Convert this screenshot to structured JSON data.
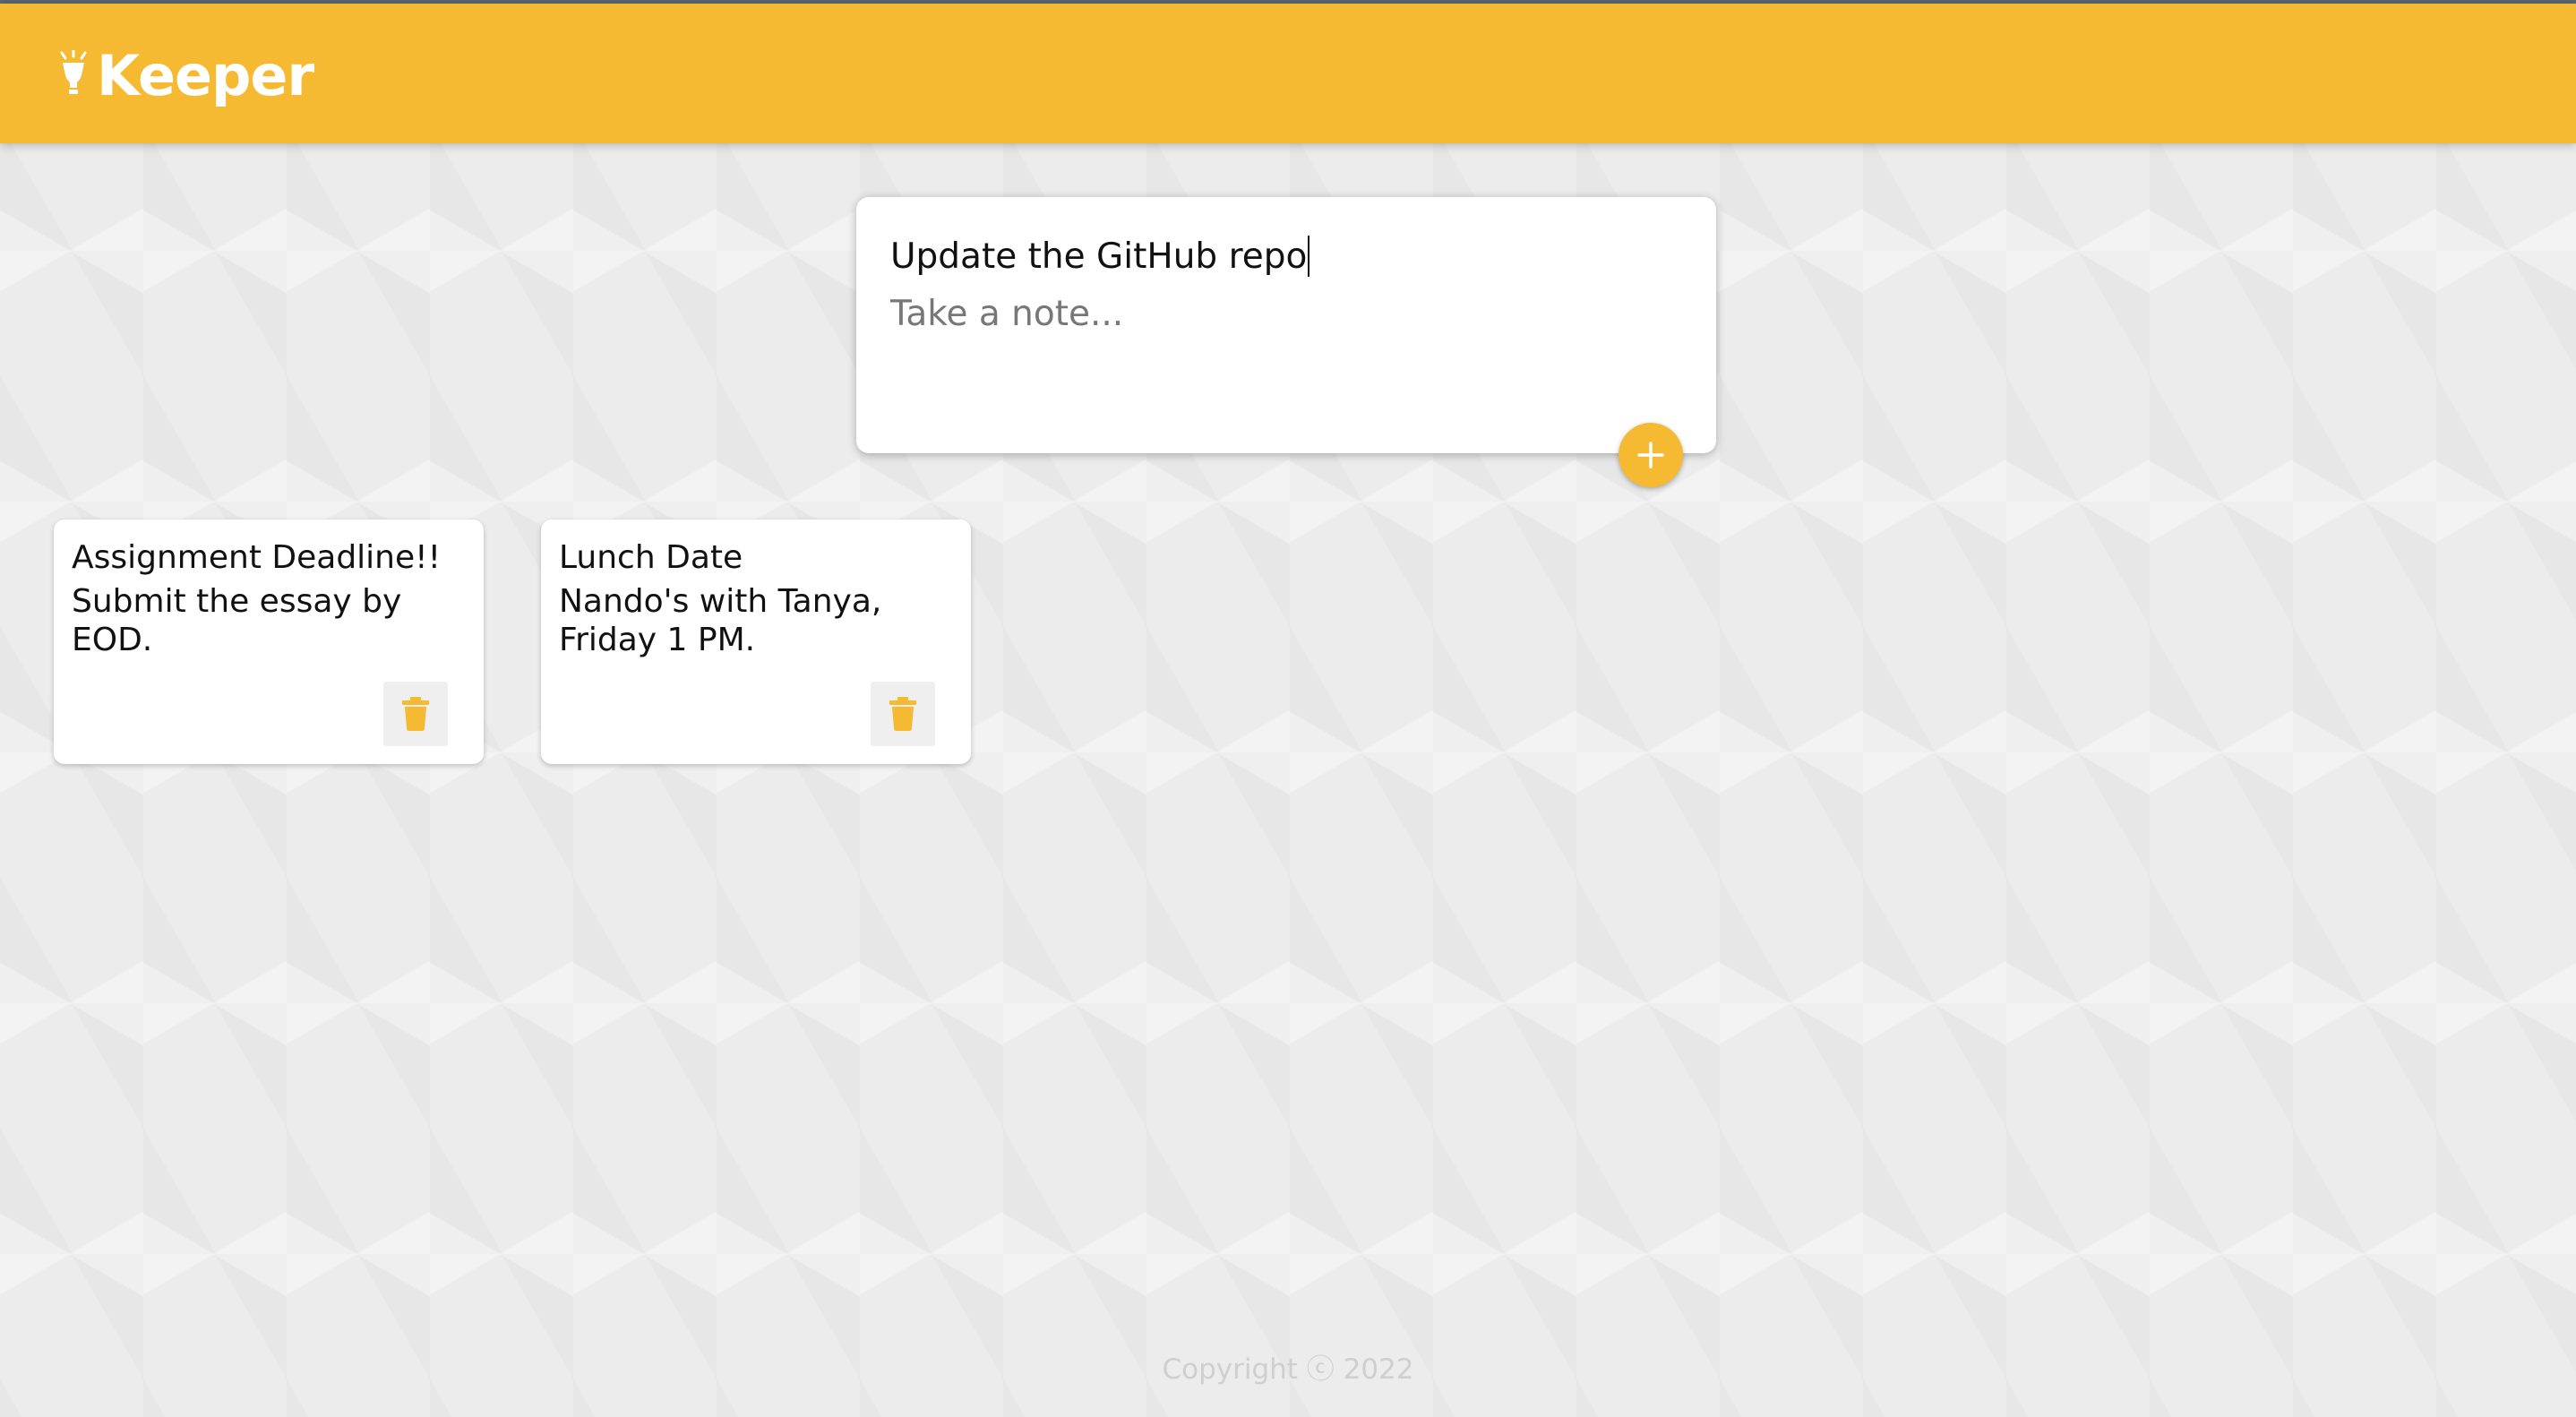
{
  "header": {
    "app_name": "Keeper",
    "logo_icon": "lightbulb-icon",
    "bg_color": "#f5ba31"
  },
  "create_note": {
    "title_value": "Update the GitHub repo",
    "content_placeholder": "Take a note...",
    "add_icon": "plus-icon"
  },
  "notes": [
    {
      "title": "Assignment Deadline!!",
      "content": "Submit the essay by EOD.",
      "delete_icon": "trash-icon"
    },
    {
      "title": "Lunch Date",
      "content": "Nando's with Tanya, Friday 1 PM.",
      "delete_icon": "trash-icon"
    }
  ],
  "footer": {
    "copyright": "Copyright ⓒ 2022"
  },
  "colors": {
    "accent": "#f5ba31",
    "background": "#ececec",
    "card": "#ffffff"
  }
}
